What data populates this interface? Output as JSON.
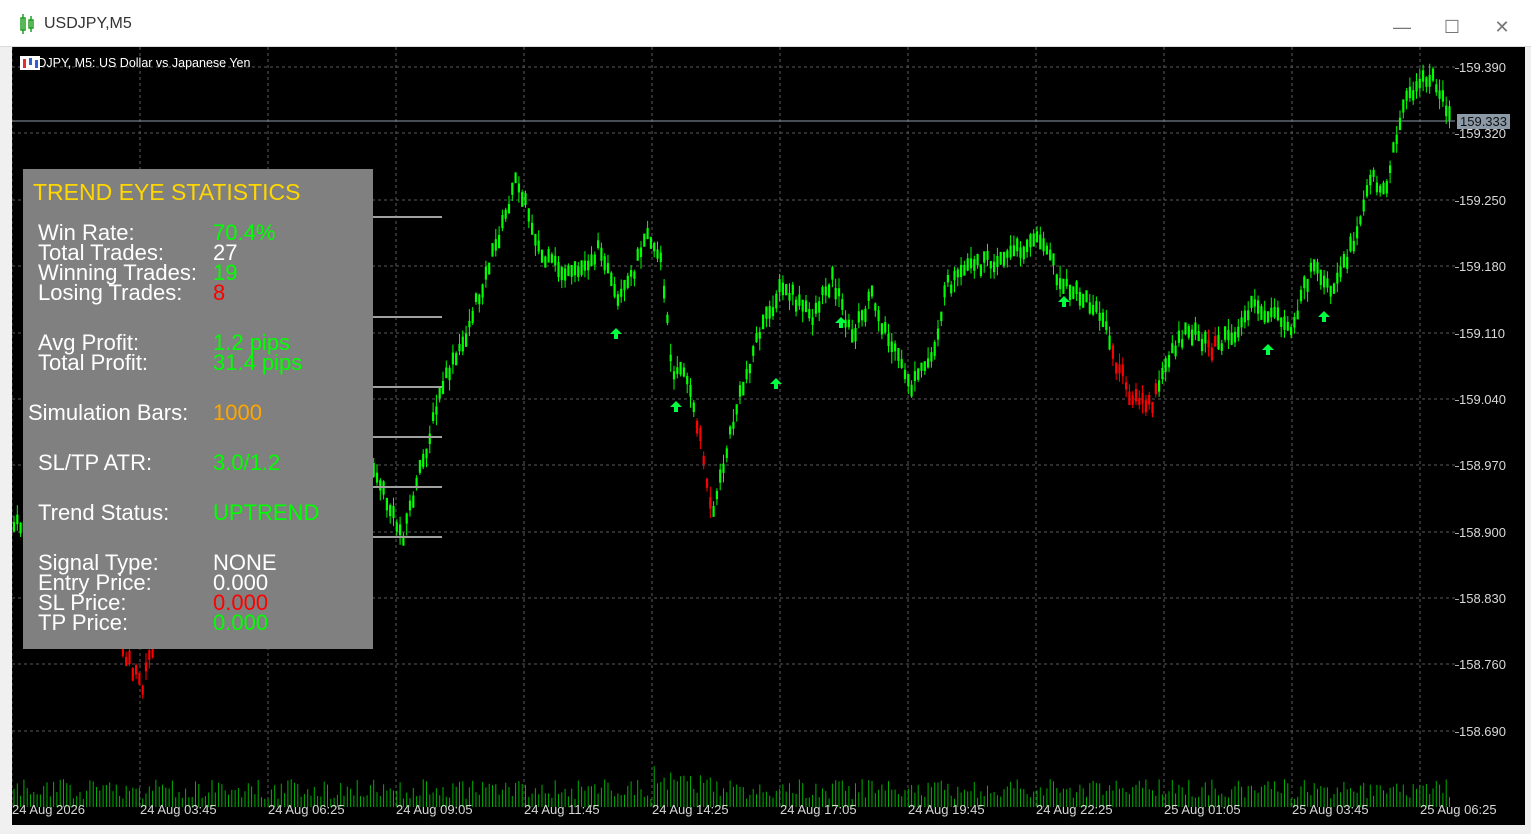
{
  "window": {
    "title": "USDJPY,M5",
    "minimize": "—",
    "maximize": "☐",
    "close": "✕"
  },
  "chart": {
    "label": "USDJPY, M5:  US Dollar vs Japanese Yen",
    "current_price": "159.333",
    "price_ticks": [
      "159.390",
      "159.320",
      "159.250",
      "159.180",
      "159.110",
      "159.040",
      "158.970",
      "158.900",
      "158.830",
      "158.760",
      "158.690"
    ],
    "time_ticks": [
      "24 Aug 2026",
      "24 Aug 03:45",
      "24 Aug 06:25",
      "24 Aug 09:05",
      "24 Aug 11:45",
      "24 Aug 14:25",
      "24 Aug 17:05",
      "24 Aug 19:45",
      "24 Aug 22:25",
      "25 Aug 01:05",
      "25 Aug 03:45",
      "25 Aug 06:25"
    ],
    "colors": {
      "bull": "#00ff00",
      "bear": "#ff0000",
      "grid": "#5a5a5a",
      "volume": "#00b000",
      "arrow": "#00ff40"
    }
  },
  "stats_panel": {
    "title": "TREND EYE STATISTICS",
    "win_rate_label": "Win Rate:",
    "win_rate": "70.4%",
    "total_trades_label": "Total Trades:",
    "total_trades": "27",
    "winning_trades_label": "Winning Trades:",
    "winning_trades": "19",
    "losing_trades_label": "Losing Trades:",
    "losing_trades": "8",
    "avg_profit_label": "Avg Profit:",
    "avg_profit": "1.2 pips",
    "total_profit_label": "Total Profit:",
    "total_profit": "31.4 pips",
    "simulation_bars_label": "Simulation Bars:",
    "simulation_bars": "1000",
    "sltp_label": "SL/TP ATR:",
    "sltp": "3.0/1.2",
    "trend_status_label": "Trend Status:",
    "trend_status": "UPTREND",
    "signal_type_label": "Signal Type:",
    "signal_type": "NONE",
    "entry_price_label": "Entry Price:",
    "entry_price": "0.000",
    "sl_price_label": "SL Price:",
    "sl_price": "0.000",
    "tp_price_label": "TP Price:",
    "tp_price": "0.000"
  }
}
